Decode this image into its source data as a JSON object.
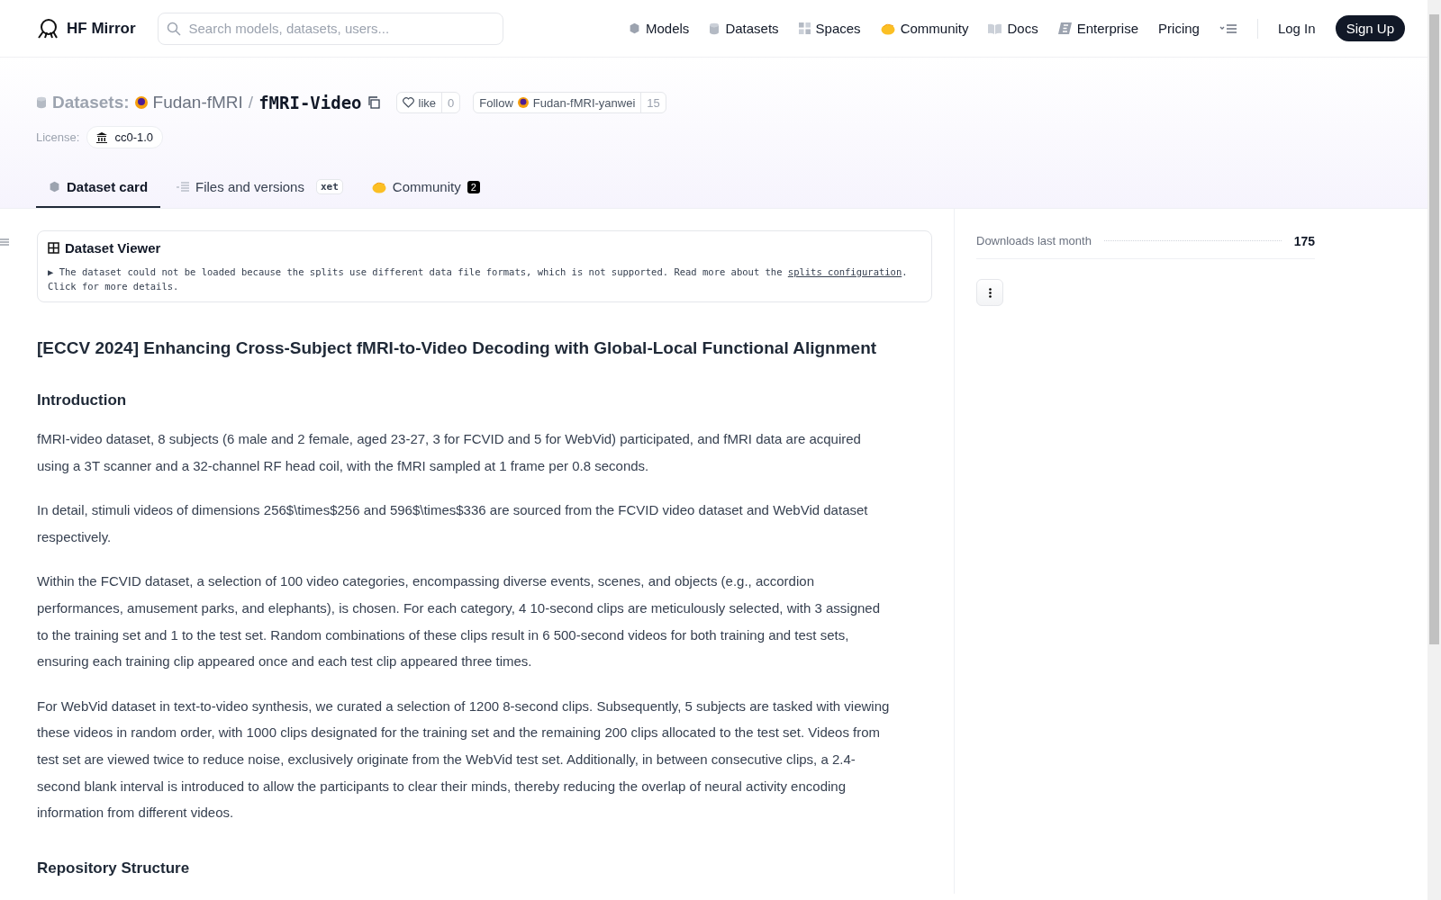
{
  "header": {
    "brand": "HF Mirror",
    "search": {
      "placeholder": "Search models, datasets, users..."
    },
    "nav": [
      {
        "label": "Models"
      },
      {
        "label": "Datasets"
      },
      {
        "label": "Spaces"
      },
      {
        "label": "Community"
      },
      {
        "label": "Docs"
      },
      {
        "label": "Enterprise"
      },
      {
        "label": "Pricing"
      }
    ],
    "login": "Log In",
    "signup": "Sign Up"
  },
  "repo": {
    "type": "Datasets:",
    "owner": "Fudan-fMRI",
    "separator": "/",
    "name": "fMRI-Video",
    "like": "like",
    "likes": "0",
    "follow": "Follow",
    "follow_user": "Fudan-fMRI-yanwei",
    "followers": "15",
    "license_label": "License:",
    "license": "cc0-1.0"
  },
  "tabs": [
    {
      "label": "Dataset card",
      "selected": true
    },
    {
      "label": "Files and versions",
      "selected": false,
      "badge": "xet"
    },
    {
      "label": "Community",
      "selected": false,
      "count": "2"
    }
  ],
  "viewer": {
    "title": "Dataset Viewer",
    "marker": "▶",
    "before": "The dataset could not be loaded because the splits use different data file formats, which is not supported. Read more about the ",
    "link": "splits configuration",
    "after": ". Click for more details."
  },
  "card": {
    "title": "[ECCV 2024] Enhancing Cross-Subject fMRI-to-Video Decoding with Global-Local Functional Alignment",
    "sections": [
      {
        "heading": "Introduction",
        "paragraphs": [
          "fMRI-video dataset, 8 subjects (6 male and 2 female, aged 23-27, 3 for FCVID and 5 for WebVid) participated, and fMRI data are acquired using a 3T scanner and a 32-channel RF head coil, with the fMRI sampled at 1 frame per 0.8 seconds.",
          "In detail, stimuli videos of dimensions 256$\\times$256 and 596$\\times$336 are sourced from the FCVID video dataset and WebVid dataset respectively.",
          "Within the FCVID dataset, a selection of 100 video categories, encompassing diverse events, scenes, and objects (e.g., accordion performances, amusement parks, and elephants), is chosen. For each category, 4 10-second clips are meticulously selected, with 3 assigned to the training set and 1 to the test set. Random combinations of these clips result in 6 500-second videos for both training and test sets, ensuring each training clip appeared once and each test clip appeared three times.",
          "For WebVid dataset in text-to-video synthesis, we curated a selection of 1200 8-second clips. Subsequently, 5 subjects are tasked with viewing these videos in random order, with 1000 clips designated for the training set and the remaining 200 clips allocated to the test set. Videos from test set are viewed twice to reduce noise, exclusively originate from the WebVid test set. Additionally, in between consecutive clips, a 2.4-second blank interval is introduced to allow the participants to clear their minds, thereby reducing the overlap of neural activity encoding information from different videos."
        ]
      },
      {
        "heading": "Repository Structure"
      }
    ]
  },
  "sidebar": {
    "downloads_label": "Downloads last month",
    "downloads": "175"
  }
}
